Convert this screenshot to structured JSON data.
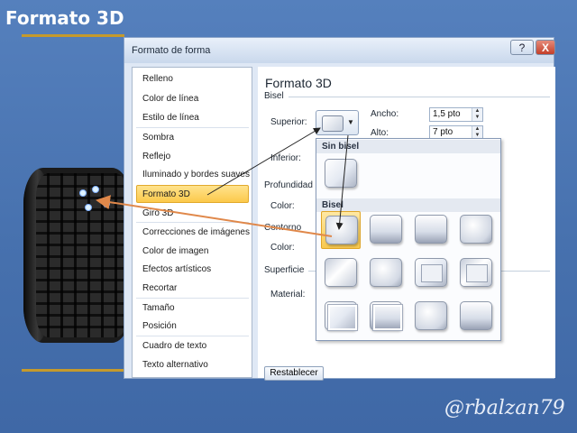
{
  "slide": {
    "title": "Formato 3D",
    "signature": "@rbalzan79",
    "accent": "#c59a2c",
    "background": "#4a76b4"
  },
  "window": {
    "title": "Formato de forma",
    "help": "?",
    "close": "X"
  },
  "nav": {
    "items": [
      "Relleno",
      "Color de línea",
      "Estilo de línea",
      "Sombra",
      "Reflejo",
      "Iluminado y bordes suaves",
      "Formato 3D",
      "Giro 3D",
      "Correcciones de imágenes",
      "Color de imagen",
      "Efectos artísticos",
      "Recortar",
      "Tamaño",
      "Posición",
      "Cuadro de texto",
      "Texto alternativo"
    ],
    "selected": "Formato 3D"
  },
  "panel": {
    "title": "Formato 3D",
    "bevel_group": "Bisel",
    "top_label": "Superior:",
    "bottom_label": "Inferior:",
    "width_label": "Ancho:",
    "width_value": "1,5 pto",
    "height_label": "Alto:",
    "height_value": "7 pto",
    "depth_label": "Profundidad",
    "depth_color_label": "Color:",
    "contour_label": "Contorno",
    "contour_color_label": "Color:",
    "surface_group": "Superficie",
    "material_label": "Material:",
    "reset_label": "Restablecer"
  },
  "gallery": {
    "no_bevel_header": "Sin bisel",
    "bevel_header": "Bisel"
  }
}
